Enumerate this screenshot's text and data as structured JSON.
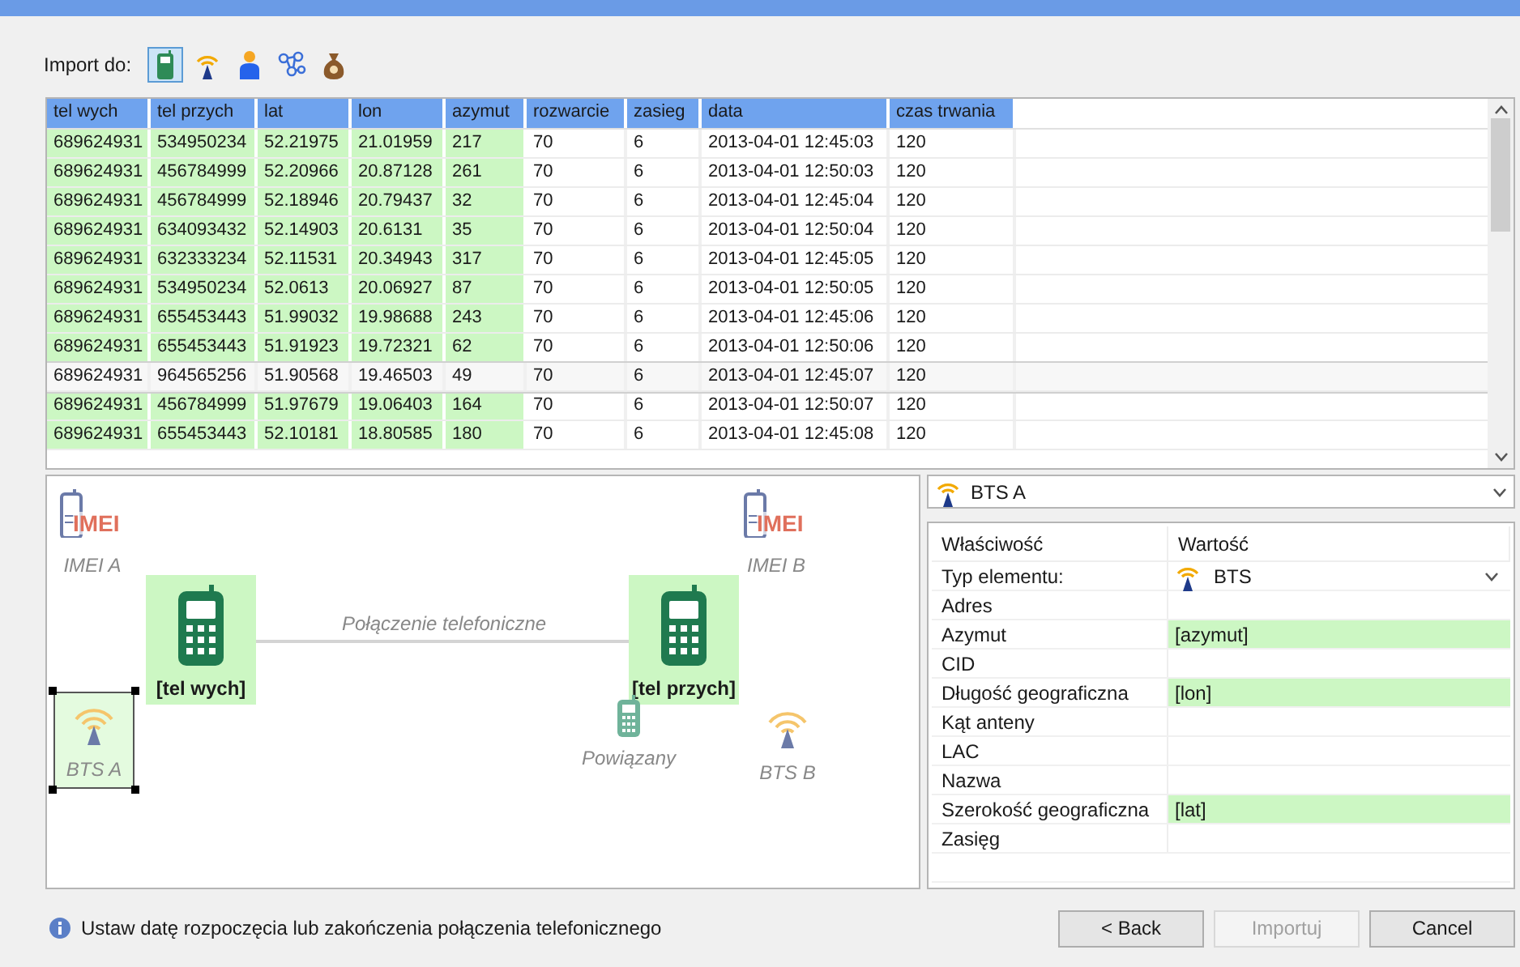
{
  "import_toolbar": {
    "label": "Import do:",
    "buttons": [
      {
        "kind": "phone",
        "selected": true
      },
      {
        "kind": "bts",
        "selected": false
      },
      {
        "kind": "person",
        "selected": false
      },
      {
        "kind": "network",
        "selected": false
      },
      {
        "kind": "moneybag",
        "selected": false
      }
    ]
  },
  "table": {
    "columns": [
      {
        "label": "tel wych",
        "mapped": true
      },
      {
        "label": "tel przych",
        "mapped": true
      },
      {
        "label": "lat",
        "mapped": true
      },
      {
        "label": "lon",
        "mapped": true
      },
      {
        "label": "azymut",
        "mapped": true
      },
      {
        "label": "rozwarcie",
        "mapped": false
      },
      {
        "label": "zasieg",
        "mapped": false
      },
      {
        "label": "data",
        "mapped": false
      },
      {
        "label": "czas trwania",
        "mapped": false
      }
    ],
    "rows": [
      {
        "selected": false,
        "cells": [
          "689624931",
          "534950234",
          "52.21975",
          "21.01959",
          "217",
          "70",
          "6",
          "2013-04-01 12:45:03",
          "120"
        ]
      },
      {
        "selected": false,
        "cells": [
          "689624931",
          "456784999",
          "52.20966",
          "20.87128",
          "261",
          "70",
          "6",
          "2013-04-01 12:50:03",
          "120"
        ]
      },
      {
        "selected": false,
        "cells": [
          "689624931",
          "456784999",
          "52.18946",
          "20.79437",
          "32",
          "70",
          "6",
          "2013-04-01 12:45:04",
          "120"
        ]
      },
      {
        "selected": false,
        "cells": [
          "689624931",
          "634093432",
          "52.14903",
          "20.6131",
          "35",
          "70",
          "6",
          "2013-04-01 12:50:04",
          "120"
        ]
      },
      {
        "selected": false,
        "cells": [
          "689624931",
          "632333234",
          "52.11531",
          "20.34943",
          "317",
          "70",
          "6",
          "2013-04-01 12:45:05",
          "120"
        ]
      },
      {
        "selected": false,
        "cells": [
          "689624931",
          "534950234",
          "52.0613",
          "20.06927",
          "87",
          "70",
          "6",
          "2013-04-01 12:50:05",
          "120"
        ]
      },
      {
        "selected": false,
        "cells": [
          "689624931",
          "655453443",
          "51.99032",
          "19.98688",
          "243",
          "70",
          "6",
          "2013-04-01 12:45:06",
          "120"
        ]
      },
      {
        "selected": false,
        "cells": [
          "689624931",
          "655453443",
          "51.91923",
          "19.72321",
          "62",
          "70",
          "6",
          "2013-04-01 12:50:06",
          "120"
        ]
      },
      {
        "selected": true,
        "cells": [
          "689624931",
          "964565256",
          "51.90568",
          "19.46503",
          "49",
          "70",
          "6",
          "2013-04-01 12:45:07",
          "120"
        ]
      },
      {
        "selected": false,
        "cells": [
          "689624931",
          "456784999",
          "51.97679",
          "19.06403",
          "164",
          "70",
          "6",
          "2013-04-01 12:50:07",
          "120"
        ]
      },
      {
        "selected": false,
        "cells": [
          "689624931",
          "655453443",
          "52.10181",
          "18.80585",
          "180",
          "70",
          "6",
          "2013-04-01 12:45:08",
          "120"
        ]
      }
    ]
  },
  "diagram": {
    "nodes": [
      {
        "kind": "imei",
        "icon_text": "IMEI",
        "label": "IMEI A"
      },
      {
        "kind": "phone",
        "label": "[tel wych]",
        "mapped": true,
        "selected": false
      },
      {
        "kind": "bts",
        "label": "BTS A",
        "mapped": true,
        "selected": true
      },
      {
        "kind": "phone",
        "label": "[tel przych]",
        "mapped": true,
        "selected": false
      },
      {
        "kind": "small_phone",
        "label": "Powiązany"
      },
      {
        "kind": "imei",
        "icon_text": "IMEI",
        "label": "IMEI B"
      },
      {
        "kind": "bts",
        "label": "BTS B",
        "mapped": false,
        "selected": false
      }
    ],
    "connection": {
      "label": "Połączenie telefoniczne"
    }
  },
  "properties": {
    "selector": {
      "value": "BTS A"
    },
    "columns": [
      "Właściwość",
      "Wartość"
    ],
    "rows": [
      {
        "name": "Typ elementu:",
        "kind": "combo",
        "value": "BTS",
        "mapped": false
      },
      {
        "name": "Adres",
        "kind": "text",
        "mapped": false
      },
      {
        "name": "Azymut",
        "kind": "text",
        "value": "[azymut]",
        "mapped": true
      },
      {
        "name": "CID",
        "kind": "text",
        "mapped": false
      },
      {
        "name": "Długość geograficzna",
        "kind": "text",
        "value": "[lon]",
        "mapped": true
      },
      {
        "name": "Kąt anteny",
        "kind": "text",
        "mapped": false
      },
      {
        "name": "LAC",
        "kind": "text",
        "mapped": false
      },
      {
        "name": "Nazwa",
        "kind": "text",
        "mapped": false
      },
      {
        "name": "Szerokość geograficzna",
        "kind": "text",
        "value": "[lat]",
        "mapped": true
      },
      {
        "name": "Zasięg",
        "kind": "text",
        "mapped": false
      }
    ]
  },
  "status": {
    "message": "Ustaw datę rozpoczęcia lub zakończenia połączenia telefonicznego"
  },
  "buttons": [
    {
      "label": "< Back",
      "disabled": false
    },
    {
      "label": "Importuj",
      "disabled": true
    },
    {
      "label": "Cancel",
      "disabled": false
    }
  ]
}
